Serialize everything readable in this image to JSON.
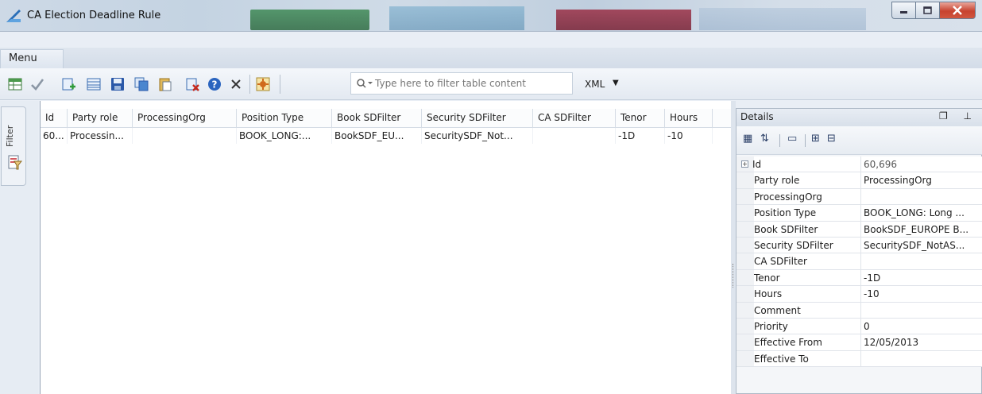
{
  "window": {
    "title": "CA Election Deadline Rule",
    "minimize_icon": "minimize-icon",
    "maximize_icon": "maximize-icon",
    "close_icon": "close-icon"
  },
  "menubar": {
    "menu_label": "Menu"
  },
  "toolbar": {
    "icons": [
      "grid-icon",
      "check-icon",
      "add-row-icon",
      "table-icon",
      "save-icon",
      "copy-icon",
      "paste-icon",
      "delete-row-icon",
      "help-icon",
      "close-icon",
      "settings-icon"
    ],
    "filter_placeholder": "Type here to filter table content",
    "format_label": "XML"
  },
  "filter_tab": {
    "label": "Filter"
  },
  "table": {
    "columns": [
      "Id",
      "Party role",
      "ProcessingOrg",
      "Position Type",
      "Book SDFilter",
      "Security SDFilter",
      "CA SDFilter",
      "Tenor",
      "Hours"
    ],
    "rows": [
      [
        "60...",
        "Processin...",
        "",
        "BOOK_LONG:...",
        "BookSDF_EU...",
        "SecuritySDF_Not...",
        "",
        "-1D",
        "-10"
      ]
    ]
  },
  "details": {
    "title": "Details",
    "header_controls": "❐ ⊥",
    "properties": [
      {
        "name": "Id",
        "value": "60,696"
      },
      {
        "name": "Party role",
        "value": "ProcessingOrg"
      },
      {
        "name": "ProcessingOrg",
        "value": ""
      },
      {
        "name": "Position Type",
        "value": "BOOK_LONG: Long ..."
      },
      {
        "name": "Book SDFilter",
        "value": "BookSDF_EUROPE B..."
      },
      {
        "name": "Security SDFilter",
        "value": "SecuritySDF_NotAS..."
      },
      {
        "name": "CA SDFilter",
        "value": ""
      },
      {
        "name": "Tenor",
        "value": "-1D"
      },
      {
        "name": "Hours",
        "value": "-10"
      },
      {
        "name": "Comment",
        "value": ""
      },
      {
        "name": "Priority",
        "value": "0"
      },
      {
        "name": "Effective From",
        "value": "12/05/2013"
      },
      {
        "name": "Effective To",
        "value": ""
      }
    ]
  }
}
